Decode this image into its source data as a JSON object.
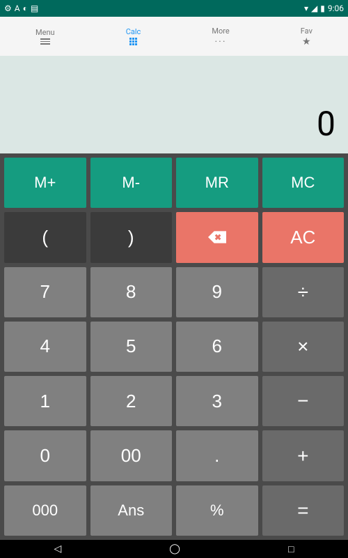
{
  "status_bar": {
    "time": "9:06",
    "icons_left": [
      "settings",
      "A",
      "sync",
      "doc"
    ],
    "icons_right": [
      "wifi",
      "signal",
      "battery"
    ]
  },
  "tabs": [
    {
      "label": "Menu",
      "icon": "menu"
    },
    {
      "label": "Calc",
      "icon": "grid",
      "active": true
    },
    {
      "label": "More",
      "icon": "dots"
    },
    {
      "label": "Fav",
      "icon": "star"
    }
  ],
  "display": "0",
  "buttons": {
    "m_plus": "M+",
    "m_minus": "M-",
    "m_recall": "MR",
    "m_clear": "MC",
    "paren_open": "(",
    "paren_close": ")",
    "all_clear": "AC",
    "n7": "7",
    "n8": "8",
    "n9": "9",
    "n4": "4",
    "n5": "5",
    "n6": "6",
    "n1": "1",
    "n2": "2",
    "n3": "3",
    "n0": "0",
    "n00": "00",
    "n000": "000",
    "dot": ".",
    "ans": "Ans",
    "percent": "%",
    "divide": "÷",
    "multiply": "×",
    "minus": "−",
    "plus": "+",
    "equals": "="
  }
}
